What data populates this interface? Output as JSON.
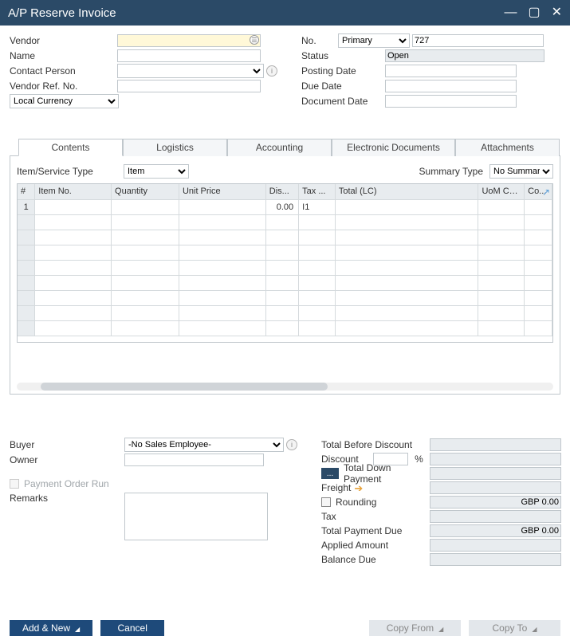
{
  "window": {
    "title": "A/P Reserve Invoice"
  },
  "header": {
    "left": {
      "vendor_label": "Vendor",
      "vendor_value": "",
      "name_label": "Name",
      "name_value": "",
      "contact_label": "Contact Person",
      "contact_value": "",
      "vendorref_label": "Vendor Ref. No.",
      "vendorref_value": "",
      "currency_value": "Local Currency"
    },
    "right": {
      "no_label": "No.",
      "series_value": "Primary",
      "docnum_value": "727",
      "status_label": "Status",
      "status_value": "Open",
      "posting_label": "Posting Date",
      "posting_value": "",
      "due_label": "Due Date",
      "due_value": "",
      "docdate_label": "Document Date",
      "docdate_value": ""
    }
  },
  "tabs": {
    "contents": "Contents",
    "logistics": "Logistics",
    "accounting": "Accounting",
    "edocs": "Electronic Documents",
    "attachments": "Attachments"
  },
  "contents": {
    "itemtype_label": "Item/Service Type",
    "itemtype_value": "Item",
    "summary_label": "Summary Type",
    "summary_value": "No Summary",
    "columns": {
      "rownum": "#",
      "item": "Item No.",
      "qty": "Quantity",
      "price": "Unit Price",
      "disc": "Dis...",
      "tax": "Tax ...",
      "total": "Total (LC)",
      "uom": "UoM Code",
      "country": "Co..."
    },
    "rows": [
      {
        "n": "1",
        "item": "",
        "qty": "",
        "price": "",
        "disc": "0.00",
        "tax": "I1",
        "total": "",
        "uom": "",
        "country": ""
      }
    ]
  },
  "bottom": {
    "buyer_label": "Buyer",
    "buyer_value": "-No Sales Employee-",
    "owner_label": "Owner",
    "owner_value": "",
    "porun_label": "Payment Order Run",
    "remarks_label": "Remarks",
    "remarks_value": ""
  },
  "totals": {
    "tbd_label": "Total Before Discount",
    "tbd_value": "",
    "discount_label": "Discount",
    "discount_pct": "",
    "pct_suffix": "%",
    "discount_value": "",
    "tdp_label": "Total Down Payment",
    "tdp_value": "",
    "freight_label": "Freight",
    "freight_value": "",
    "rounding_label": "Rounding",
    "rounding_value": "GBP 0.00",
    "tax_label": "Tax",
    "tax_value": "",
    "tpd_label": "Total Payment Due",
    "tpd_value": "GBP 0.00",
    "applied_label": "Applied Amount",
    "applied_value": "",
    "balance_label": "Balance Due",
    "balance_value": ""
  },
  "footer": {
    "addnew": "Add & New",
    "cancel": "Cancel",
    "copyfrom": "Copy From",
    "copyto": "Copy To"
  }
}
